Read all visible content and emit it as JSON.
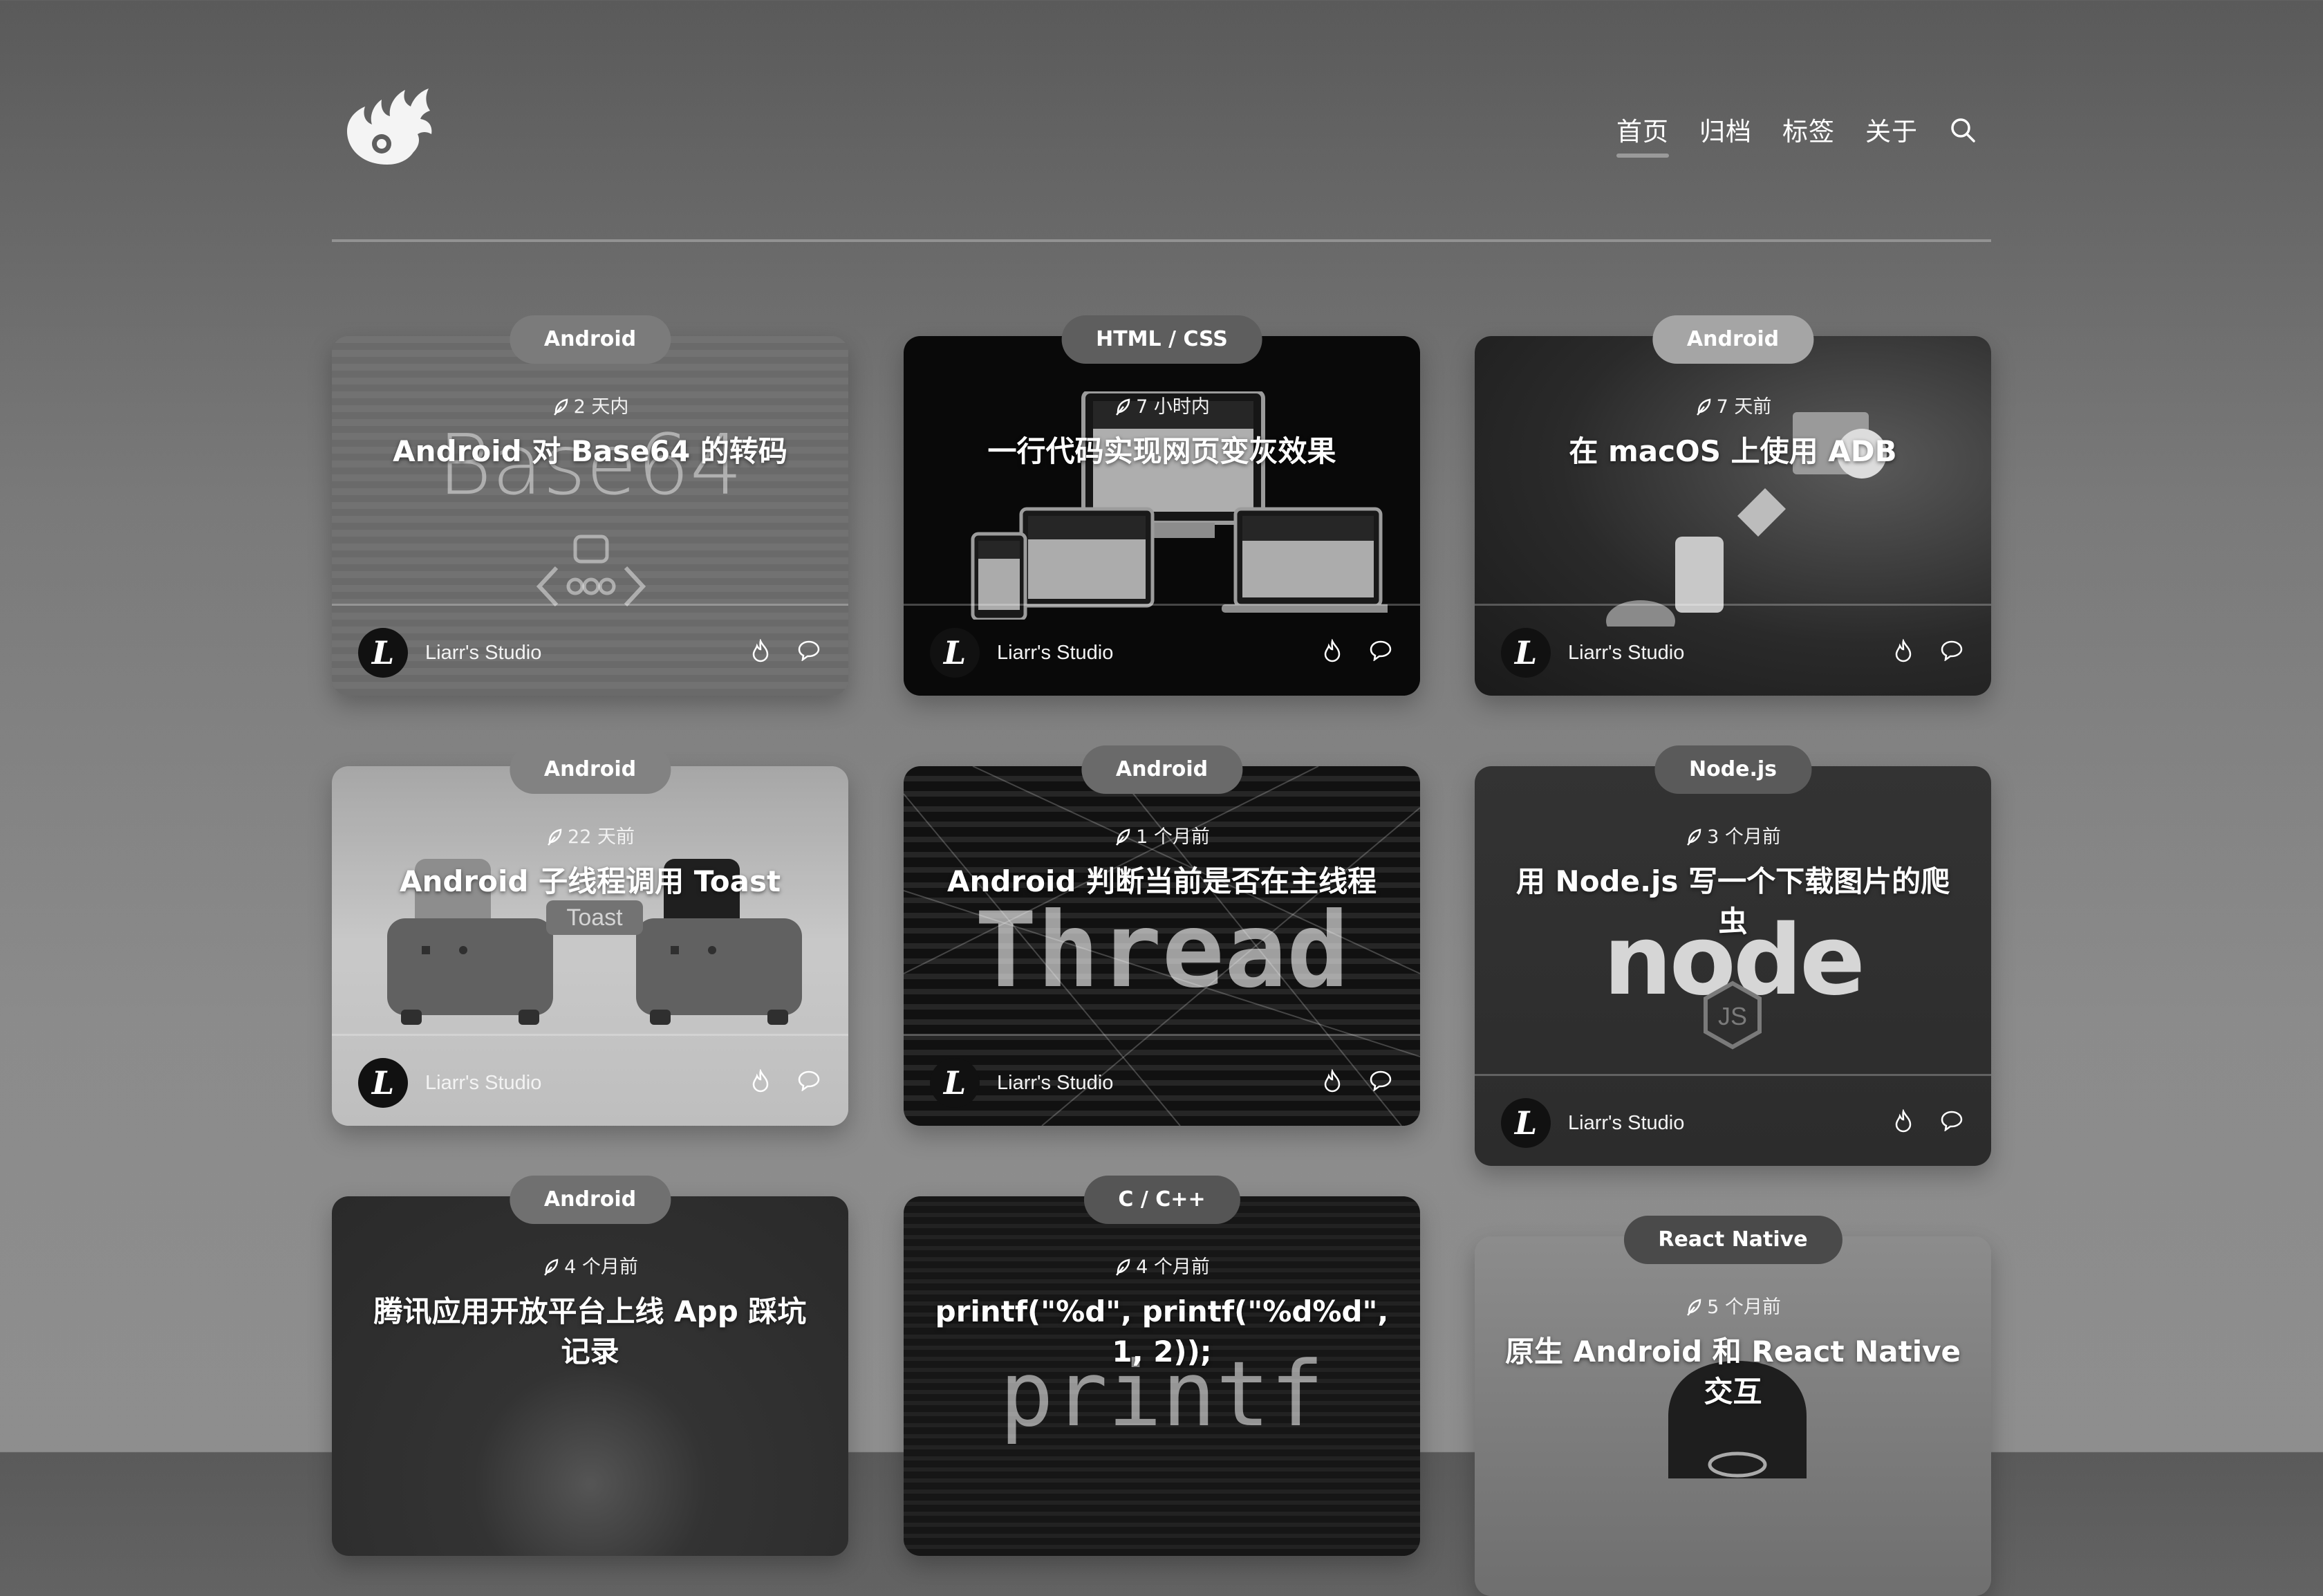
{
  "nav": {
    "items": [
      {
        "label": "首页",
        "active": true
      },
      {
        "label": "归档",
        "active": false
      },
      {
        "label": "标签",
        "active": false
      },
      {
        "label": "关于",
        "active": false
      }
    ]
  },
  "author": {
    "name": "Liarr's Studio",
    "avatar_letter": "L"
  },
  "cards": [
    {
      "tag": "Android",
      "time": "2 天内",
      "title": "Android 对 Base64 的转码",
      "cover": "Base64"
    },
    {
      "tag": "HTML / CSS",
      "time": "7 小时内",
      "title": "一行代码实现网页变灰效果",
      "cover": "devices"
    },
    {
      "tag": "Android",
      "time": "7 天前",
      "title": "在 macOS 上使用 ADB",
      "cover": "adb"
    },
    {
      "tag": "Android",
      "time": "22 天前",
      "title": "Android 子线程调用 Toast",
      "cover": "Toast"
    },
    {
      "tag": "Android",
      "time": "1 个月前",
      "title": "Android 判断当前是否在主线程",
      "cover": "Thread"
    },
    {
      "tag": "Node.js",
      "time": "3 个月前",
      "title": "用 Node.js 写一个下载图片的爬虫",
      "cover": "node"
    },
    {
      "tag": "Android",
      "time": "4 个月前",
      "title": "腾讯应用开放平台上线 App 踩坑记录",
      "cover": ""
    },
    {
      "tag": "C / C++",
      "time": "4 个月前",
      "title": "printf(\"%d\", printf(\"%d%d\", 1, 2));",
      "cover": "printf"
    },
    {
      "tag": "React Native",
      "time": "5 个月前",
      "title": "原生 Android 和 React Native 交互",
      "cover": ""
    }
  ]
}
